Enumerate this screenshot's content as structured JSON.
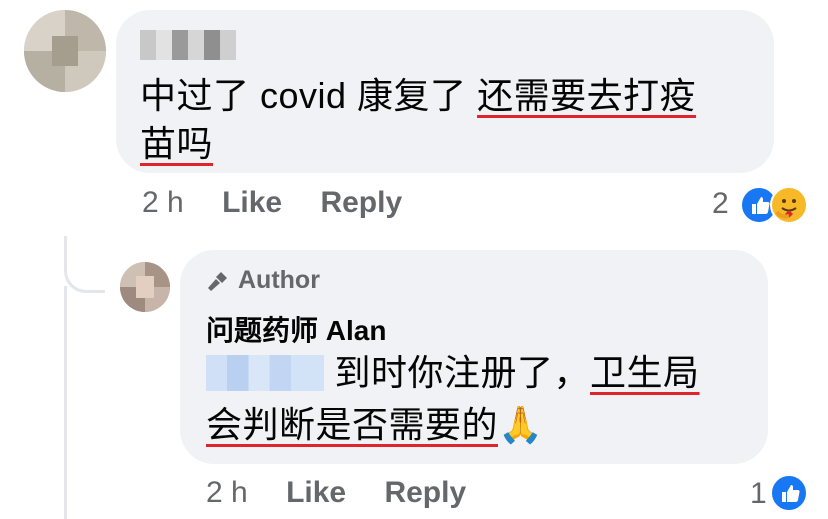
{
  "comment1": {
    "text_plain": "中过了 covid 康复了 ",
    "text_underlined_1": "还需要去打疫",
    "text_underlined_2": "苗吗",
    "time": "2 h",
    "like_label": "Like",
    "reply_label": "Reply",
    "reaction_count": "2",
    "reactions": [
      "like-icon",
      "care-icon"
    ]
  },
  "reply1": {
    "badge_label": "Author",
    "author_name": "问题药师 Alan",
    "text_plain": " 到时你注册了，",
    "text_underlined_1": "卫生局",
    "text_underlined_2": "会判断是否需要的",
    "emoji": "🙏",
    "time": "2 h",
    "like_label": "Like",
    "reply_label": "Reply",
    "reaction_count": "1",
    "reactions": [
      "like-icon"
    ]
  },
  "colors": {
    "bubble": "#f0f2f5",
    "secondary_text": "#65676b",
    "like_blue": "#1877f2",
    "underline_red": "#e0242b"
  }
}
